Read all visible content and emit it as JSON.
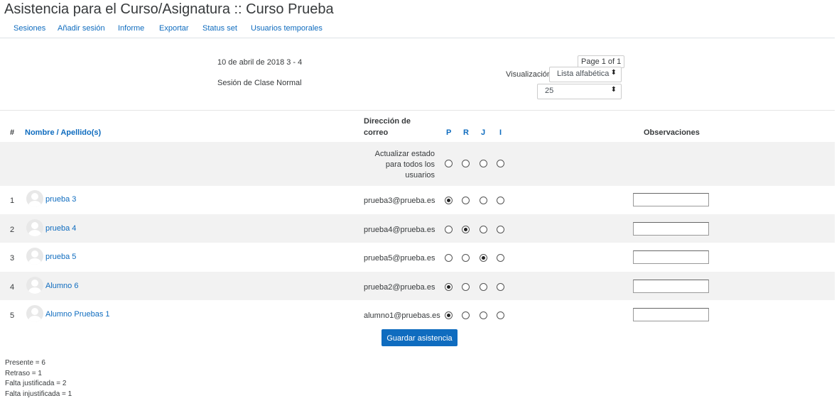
{
  "page": {
    "title": "Asistencia para el Curso/Asignatura :: Curso Prueba"
  },
  "tabs": [
    "Sesiones",
    "Añadir sesión",
    "Informe",
    "Exportar",
    "Status set",
    "Usuarios temporales"
  ],
  "session": {
    "date": "10 de abril de 2018 3 - 4",
    "description": "Sesión de Clase Normal"
  },
  "pager": {
    "label": "Page 1 of 1"
  },
  "view": {
    "label": "Visualización",
    "mode": "Lista alfabética",
    "per_page": "25"
  },
  "table": {
    "headers": {
      "num": "#",
      "name": "Nombre / Apellido(s)",
      "email_line1": "Dirección de",
      "email_line2": "correo",
      "p": "P",
      "r": "R",
      "j": "J",
      "i": "I",
      "obs": "Observaciones"
    },
    "update_all": [
      "Actualizar estado",
      "para todos los",
      "usuarios"
    ],
    "rows": [
      {
        "num": "1",
        "name": "prueba 3",
        "email": "prueba3@prueba.es",
        "status": "P"
      },
      {
        "num": "2",
        "name": "prueba 4",
        "email": "prueba4@prueba.es",
        "status": "R"
      },
      {
        "num": "3",
        "name": "prueba 5",
        "email": "prueba5@prueba.es",
        "status": "J"
      },
      {
        "num": "4",
        "name": "Alumno 6",
        "email": "prueba2@prueba.es",
        "status": "P"
      },
      {
        "num": "5",
        "name": "Alumno Pruebas 1",
        "email": "alumno1@pruebas.es",
        "status": "P"
      }
    ]
  },
  "save_button": "Guardar asistencia",
  "summary": [
    "Presente = 6",
    "Retraso = 1",
    "Falta justificada = 2",
    "Falta injustificada = 1"
  ]
}
